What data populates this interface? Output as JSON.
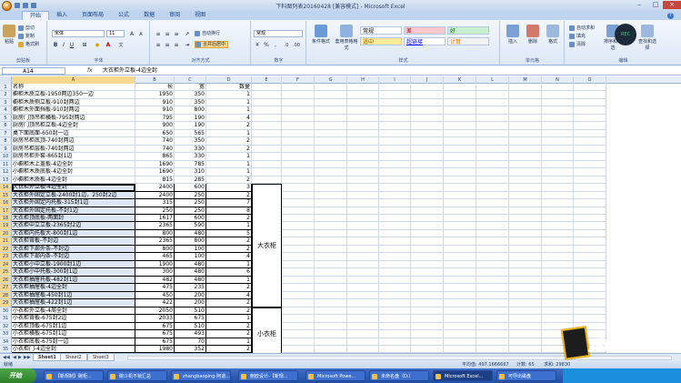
{
  "window": {
    "title": "下料图列表20160428 [兼容模式] - Microsoft Excel"
  },
  "ribbon": {
    "tabs": [
      "开始",
      "插入",
      "页面布局",
      "公式",
      "数据",
      "审阅",
      "视图"
    ],
    "active_tab": "开始",
    "clipboard": {
      "paste": "粘贴",
      "cut": "剪切",
      "copy": "复制",
      "format_painter": "格式刷",
      "label": "剪贴板"
    },
    "font": {
      "name": "宋体",
      "size": "11",
      "label": "字体"
    },
    "alignment": {
      "wrap": "自动换行",
      "merge": "合并后居中",
      "label": "对齐方式"
    },
    "number": {
      "format": "常规",
      "label": "数字"
    },
    "styles": {
      "conditional": "条件格式",
      "table": "套用表格格式",
      "cells": [
        {
          "text": "常规",
          "bg": "#ffffff",
          "fg": "#000000"
        },
        {
          "text": "差",
          "bg": "#ffc7ce",
          "fg": "#9c0006"
        },
        {
          "text": "好",
          "bg": "#c6efce",
          "fg": "#006100"
        },
        {
          "text": "适中",
          "bg": "#ffeb9c",
          "fg": "#9c5700"
        },
        {
          "text": "超链接",
          "bg": "#ffffff",
          "fg": "#0000ff"
        },
        {
          "text": "计算",
          "bg": "#f2f2f2",
          "fg": "#fa7d00"
        }
      ],
      "label": "样式"
    },
    "cells_group": {
      "insert": "插入",
      "delete": "删除",
      "format": "格式",
      "label": "单元格"
    },
    "editing": {
      "autosum": "自动求和",
      "fill": "填充",
      "clear": "清除",
      "sort": "排序和筛选",
      "find": "查找和选择",
      "label": "编辑"
    }
  },
  "formula_bar": {
    "name_box": "A14",
    "fx": "fx",
    "content": "大衣柜外立板-4边全封"
  },
  "columns": [
    "A",
    "B",
    "C",
    "D",
    "E",
    "F",
    "G",
    "H",
    "I",
    "J",
    "K",
    "L",
    "M",
    "N",
    "O"
  ],
  "selected_column": "A",
  "rows": [
    {
      "n": "1",
      "a": "名称",
      "b": "长",
      "c": "宽",
      "d": "数量"
    },
    {
      "n": "2",
      "a": "橱柜木质立板-1950两边350一边",
      "b": "1950",
      "c": "350",
      "d": "1"
    },
    {
      "n": "3",
      "a": "橱柜木质侧立板-910封两边",
      "b": "910",
      "c": "350",
      "d": "1"
    },
    {
      "n": "4",
      "a": "橱柜木外面挡板-910封两边",
      "b": "910",
      "c": "800",
      "d": "1"
    },
    {
      "n": "5",
      "a": "厨房门顶吊柜横板-795封两边",
      "b": "795",
      "c": "190",
      "d": "4"
    },
    {
      "n": "6",
      "a": "厨房门顶吊柜立板-4边全封",
      "b": "900",
      "c": "190",
      "d": "2"
    },
    {
      "n": "7",
      "a": "桌下面底面-650封一边",
      "b": "650",
      "c": "565",
      "d": "1"
    },
    {
      "n": "8",
      "a": "厨房吊柜底顶-740封两边",
      "b": "740",
      "c": "350",
      "d": "2"
    },
    {
      "n": "9",
      "a": "厨房吊柜层板-740封两边",
      "b": "740",
      "c": "330",
      "d": "2"
    },
    {
      "n": "10",
      "a": "厨房吊柜外套-865封1边",
      "b": "865",
      "c": "330",
      "d": "1"
    },
    {
      "n": "11",
      "a": "小橱柜木上盖板-4边全封",
      "b": "1690",
      "c": "785",
      "d": "1"
    },
    {
      "n": "12",
      "a": "小橱柜木质底板-4边全封",
      "b": "1690",
      "c": "310",
      "d": "1"
    },
    {
      "n": "13",
      "a": "小橱柜木质板-4边全封",
      "b": "815",
      "c": "285",
      "d": "2"
    },
    {
      "n": "14",
      "a": "大衣柜外立板-4边全封",
      "b": "2400",
      "c": "600",
      "d": "3"
    },
    {
      "n": "15",
      "a": "大衣柜外固定立板-2400封1边，250封2边",
      "b": "2400",
      "c": "250",
      "d": "2"
    },
    {
      "n": "16",
      "a": "大衣柜外固定内托板-315封1边",
      "b": "315",
      "c": "250",
      "d": "7"
    },
    {
      "n": "17",
      "a": "大衣柜外固定托板-不封1边",
      "b": "250",
      "c": "250",
      "d": "8"
    },
    {
      "n": "18",
      "a": "大衣柜顶底板-两面封",
      "b": "1617",
      "c": "600",
      "d": "2"
    },
    {
      "n": "19",
      "a": "大衣柜中立立板-2365封2边",
      "b": "2365",
      "c": "590",
      "d": "1"
    },
    {
      "n": "20",
      "a": "大衣柜内托板大-800封1边",
      "b": "800",
      "c": "480",
      "d": "5"
    },
    {
      "n": "21",
      "a": "大衣柜背板-不封边",
      "b": "2365",
      "c": "800",
      "d": "2"
    },
    {
      "n": "22",
      "a": "大衣柜下部外条-不封边",
      "b": "800",
      "c": "100",
      "d": "2"
    },
    {
      "n": "23",
      "a": "大衣柜下部内条-不封边",
      "b": "465",
      "c": "100",
      "d": "4"
    },
    {
      "n": "24",
      "a": "大衣柜小中立板-1900封1边",
      "b": "1900",
      "c": "480",
      "d": "1"
    },
    {
      "n": "25",
      "a": "大衣柜小中托板-300封1边",
      "b": "300",
      "c": "480",
      "d": "6"
    },
    {
      "n": "26",
      "a": "大衣柜抽屉托板-482封1边",
      "b": "482",
      "c": "480",
      "d": "1"
    },
    {
      "n": "27",
      "a": "大衣柜抽屉板-4边全封",
      "b": "475",
      "c": "235",
      "d": "2"
    },
    {
      "n": "28",
      "a": "大衣柜抽屉板-450封1边",
      "b": "450",
      "c": "200",
      "d": "4"
    },
    {
      "n": "29",
      "a": "大衣柜抽屉板-422封1边",
      "b": "422",
      "c": "200",
      "d": "2"
    },
    {
      "n": "30",
      "a": "小衣柜外立板-4周全封",
      "b": "2050",
      "c": "510",
      "d": "2"
    },
    {
      "n": "31",
      "a": "小衣柜背板-675封2边",
      "b": "2033",
      "c": "675",
      "d": "1"
    },
    {
      "n": "32",
      "a": "小衣柜顶板-675封1边",
      "b": "675",
      "c": "510",
      "d": "2"
    },
    {
      "n": "33",
      "a": "小衣柜横板-675封1边",
      "b": "675",
      "c": "493",
      "d": "2"
    },
    {
      "n": "34",
      "a": "小衣柜底板-675封一边",
      "b": "675",
      "c": "70",
      "d": "1"
    },
    {
      "n": "35",
      "a": "小衣柜门-4边全封",
      "b": "1980",
      "c": "352",
      "d": "2"
    }
  ],
  "groups": {
    "big_wardrobe": "大衣柜",
    "small_wardrobe": "小衣柜"
  },
  "sheets": [
    "Sheet1",
    "Sheet2",
    "Sheet3"
  ],
  "active_sheet": "Sheet1",
  "status": {
    "ready": "就绪",
    "average": "平均值: 497.1666667",
    "count": "计数: 65",
    "sum": "求和: 29830"
  },
  "taskbar": {
    "start": "开始",
    "items": [
      "【新规制】碗柜...",
      "碗斗机不锁汇总",
      "zhangbaoping-阿道...",
      "鲍欧设计-【新规...",
      "Microsoft Powe...",
      "未命名盘（D:）",
      "Microsoft Excel...",
      "可导出磁盘"
    ]
  },
  "recorder": {
    "label": "REC"
  },
  "logo": {
    "text": "爱好者"
  }
}
